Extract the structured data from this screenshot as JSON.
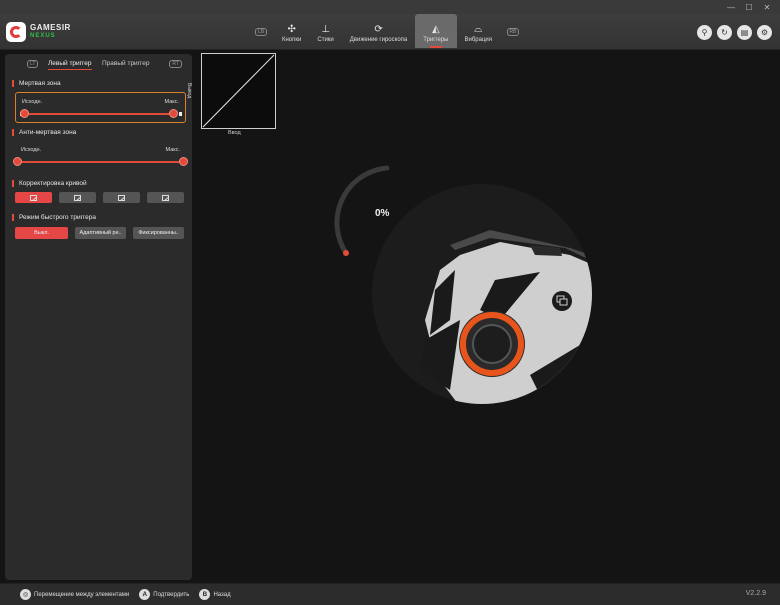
{
  "window": {
    "minimize": "—",
    "maximize": "☐",
    "close": "✕"
  },
  "logo": {
    "line1": "GAMESIR",
    "line2": "NEXUS"
  },
  "tabs": [
    {
      "label": "Кнопки",
      "icon": "dpad-icon"
    },
    {
      "label": "Стики",
      "icon": "stick-icon"
    },
    {
      "label": "Движение гироскопа",
      "icon": "gyro-icon"
    },
    {
      "label": "Триггеры",
      "icon": "trigger-icon",
      "active": true
    },
    {
      "label": "Вибрация",
      "icon": "gamepad-icon"
    }
  ],
  "bumpers": {
    "left": "LB",
    "right": "RB"
  },
  "panel": {
    "tab_left": "Левый триггер",
    "tab_right": "Правый триггер",
    "lb": "LT",
    "rb": "RT",
    "deadzone": {
      "title": "Мертвая зона",
      "min_label": "Исходн.",
      "max_label": "Макс.",
      "min_value": 0.0,
      "max_value": 1.0
    },
    "antideadzone": {
      "title": "Анти-мертвая зона",
      "min_label": "Исходн.",
      "max_label": "Макс.",
      "min_value": 0.0,
      "max_value": 1.0
    },
    "curve": {
      "title": "Корректировка кривой",
      "selected": 0
    },
    "quick": {
      "title": "Режим быстрого триггера",
      "options": [
        "Выкл.",
        "Адаптивный ре..",
        "Фиксированны.."
      ],
      "selected": 0
    }
  },
  "graph": {
    "ylabel": "Вывод",
    "xlabel": "Ввод"
  },
  "trigger_percent": "0%",
  "bottom": {
    "hint1": "Перемещение между элементами",
    "hint2": "Подтвердить",
    "hint2_key": "A",
    "hint3": "Назад",
    "hint3_key": "B",
    "version": "V2.2.9"
  },
  "colors": {
    "accent": "#e24a3a",
    "orange_ring": "#e8551c",
    "brand_green": "#32c04a"
  }
}
